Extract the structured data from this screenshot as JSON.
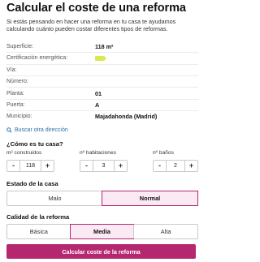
{
  "header": {
    "title": "Calcular el coste de una reforma",
    "intro": "Si estás pensando en hacer una reforma en tu casa te ayudamos calculando cuánto pueden costar diferentes tipos de reformas."
  },
  "property": [
    {
      "label": "Superficie:",
      "value": "118 m²"
    },
    {
      "label": "Certificación energética:",
      "value": ""
    },
    {
      "label": "Vía:",
      "value": ""
    },
    {
      "label": "Número:",
      "value": ""
    },
    {
      "label": "Planta:",
      "value": "01"
    },
    {
      "label": "Puerta:",
      "value": "A"
    },
    {
      "label": "Municipio:",
      "value": "Majadahonda (Madrid)"
    }
  ],
  "energy_color": "#d9e84b",
  "search_link": "Buscar otra dirección",
  "house": {
    "title": "¿Cómo es tu casa?",
    "area": {
      "label": "m² construidos",
      "value": "118",
      "minus": "-",
      "plus": "+"
    },
    "rooms": {
      "label": "nº habitaciones",
      "value": "3",
      "minus": "-",
      "plus": "+"
    },
    "baths": {
      "label": "nº baños",
      "value": "2",
      "minus": "-",
      "plus": "+"
    }
  },
  "state": {
    "title": "Estado de la casa",
    "options": [
      "Malo",
      "Normal"
    ],
    "selected": "Normal"
  },
  "quality": {
    "title": "Calidad de la reforma",
    "options": [
      "Básica",
      "Media",
      "Alta"
    ],
    "selected": "Media"
  },
  "cta_label": "Calcular coste de la reforma",
  "accent_color": "#b5286f"
}
